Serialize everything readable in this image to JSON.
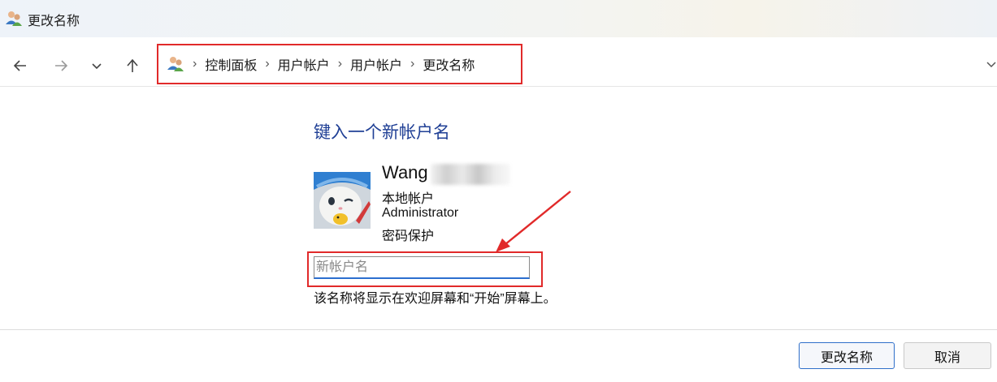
{
  "window": {
    "title": "更改名称"
  },
  "nav": {
    "back": "back-arrow-icon",
    "forward": "forward-arrow-icon",
    "recent": "chevron-down-icon",
    "up": "up-arrow-icon"
  },
  "breadcrumb": {
    "items": [
      "控制面板",
      "用户帐户",
      "用户帐户",
      "更改名称"
    ],
    "separator": "›"
  },
  "main": {
    "heading": "键入一个新帐户名",
    "account": {
      "name": "Wang",
      "type": "本地帐户",
      "role": "Administrator",
      "protection": "密码保护"
    },
    "input": {
      "placeholder": "新帐户名",
      "value": ""
    },
    "hint": "该名称将显示在欢迎屏幕和“开始”屏幕上。"
  },
  "footer": {
    "confirm_label": "更改名称",
    "cancel_label": "取消"
  },
  "colors": {
    "annotation_red": "#e12a2a",
    "heading_blue": "#1f3f95",
    "focus_blue": "#2c6fcf"
  }
}
